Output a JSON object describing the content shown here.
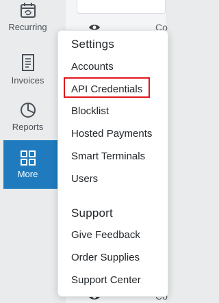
{
  "sidebar": {
    "items": [
      {
        "label": "Recurring",
        "icon": "recurring-calendar-icon"
      },
      {
        "label": "Invoices",
        "icon": "invoice-document-icon"
      },
      {
        "label": "Reports",
        "icon": "pie-chart-icon"
      },
      {
        "label": "More",
        "icon": "grid-four-squares-icon",
        "active": true
      }
    ],
    "active_color": "#1f7bbd"
  },
  "background": {
    "row_text_top": "Co",
    "row_text_bottom": "Co",
    "row_icon": "eye-icon"
  },
  "menu": {
    "settings_heading": "Settings",
    "settings_items": [
      "Accounts",
      "API Credentials",
      "Blocklist",
      "Hosted Payments",
      "Smart Terminals",
      "Users"
    ],
    "support_heading": "Support",
    "support_items": [
      "Give Feedback",
      "Order Supplies",
      "Support Center"
    ],
    "highlighted_item": "API Credentials",
    "highlight_color": "#e0161e"
  }
}
